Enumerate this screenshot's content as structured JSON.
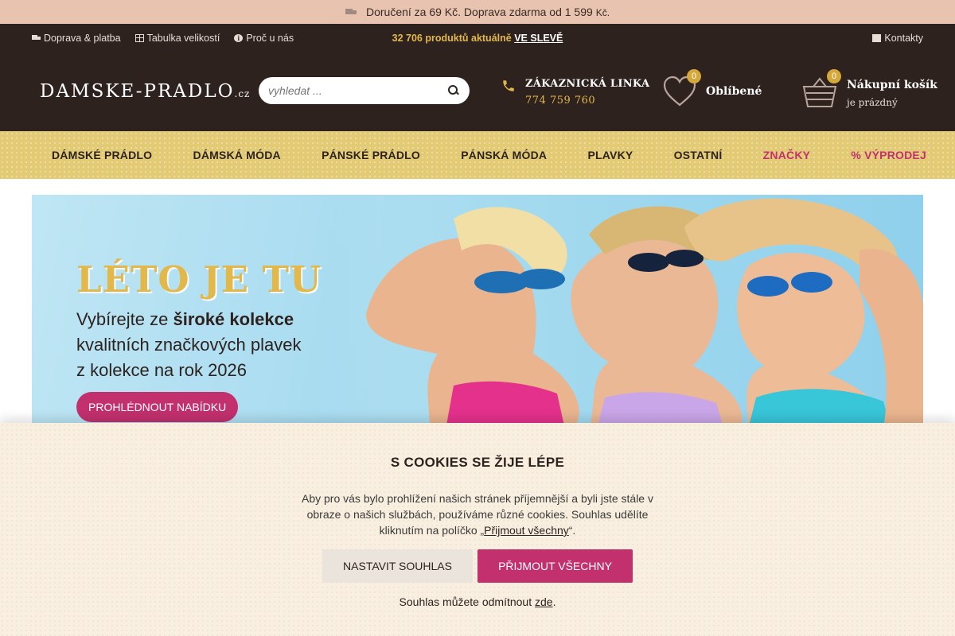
{
  "promo": {
    "text": "Doručení za 69 Kč. Doprava zdarma od 1 599",
    "currency": "Kč."
  },
  "utility": {
    "links": [
      {
        "label": "Doprava & platba",
        "icon": "truck-icon"
      },
      {
        "label": "Tabulka velikostí",
        "icon": "table-icon"
      },
      {
        "label": "Proč u nás",
        "icon": "info-icon"
      }
    ],
    "stock_text": "32 706 produktů aktuálně",
    "sale_link": "VE SLEVĚ",
    "contacts": "Kontakty"
  },
  "header": {
    "logo_main": "DAMSKE-PRADLO",
    "logo_suffix": ".cz",
    "search_placeholder": "vyhledat ...",
    "hotline_title": "ZÁKAZNICKÁ LINKA",
    "hotline_phone": "774 759 760",
    "favorites_label": "Oblíbené",
    "favorites_count": "0",
    "cart_title": "Nákupní košík",
    "cart_status": "je prázdný",
    "cart_count": "0"
  },
  "nav": [
    {
      "label": "DÁMSKÉ PRÁDLO"
    },
    {
      "label": "DÁMSKÁ MÓDA"
    },
    {
      "label": "PÁNSKÉ PRÁDLO"
    },
    {
      "label": "PÁNSKÁ MÓDA"
    },
    {
      "label": "PLAVKY"
    },
    {
      "label": "OSTATNÍ"
    },
    {
      "label": "ZNAČKY"
    },
    {
      "label": "VÝPRODEJ"
    }
  ],
  "hero": {
    "title": "LÉTO JE TU",
    "line1_pre": "Vybírejte ze ",
    "line1_bold": "široké kolekce",
    "line2": "kvalitních značkových plavek",
    "line3": "z kolekce na rok 2026",
    "cta": "PROHLÉDNOUT NABÍDKU"
  },
  "cookies": {
    "title": "S COOKIES SE ŽIJE LÉPE",
    "text_pre": "Aby pro vás bylo prohlížení našich stránek příjemnější a byli jste stále v obraze o našich službách, používáme různé cookies. Souhlas udělíte kliknutím na políčko „",
    "text_link": "Přijmout všechny",
    "text_post": "“.",
    "btn_settings": "NASTAVIT SOUHLAS",
    "btn_accept": "PŘIJMOUT VŠECHNY",
    "foot_pre": "Souhlas můžete odmítnout ",
    "foot_link": "zde",
    "foot_post": "."
  },
  "colors": {
    "dark": "#2e221f",
    "gold": "#e3b84a",
    "accent": "#c2306e",
    "nav_bg": "#e3cb75",
    "promo_bg": "#e8c4b0"
  }
}
